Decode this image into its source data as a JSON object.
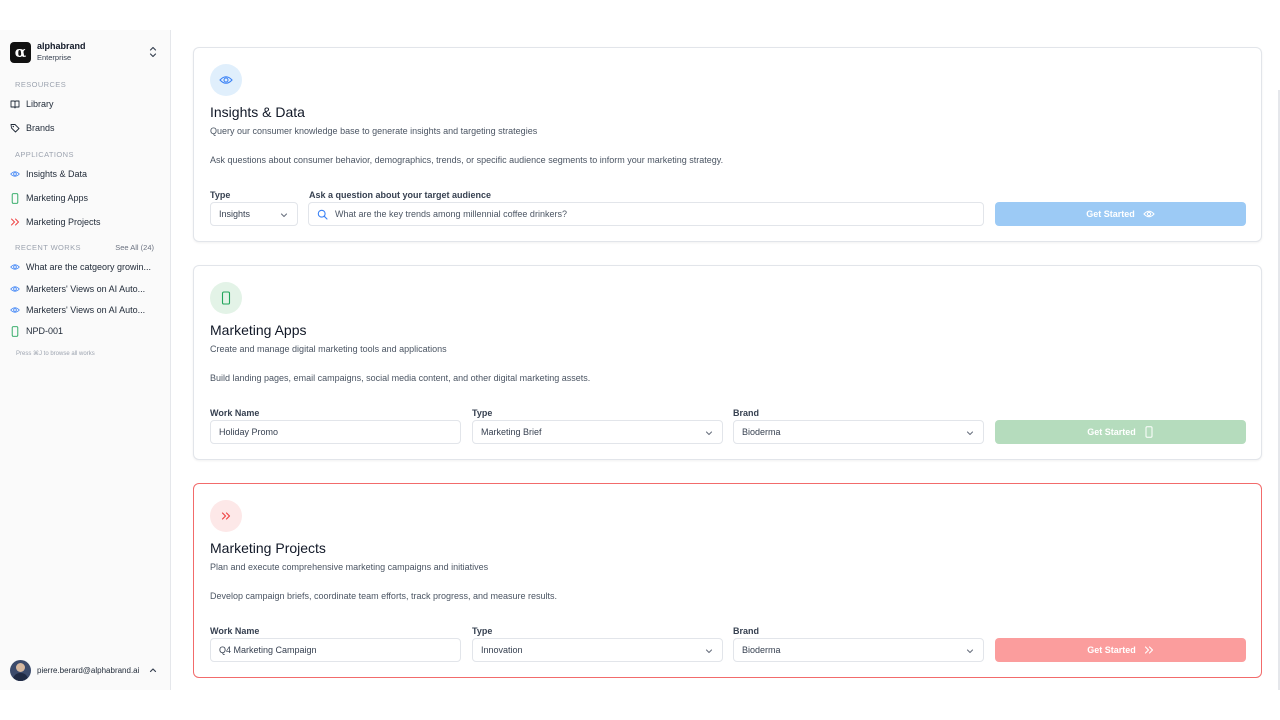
{
  "org": {
    "name": "alphabrand",
    "plan": "Enterprise",
    "logo": "α"
  },
  "sidebar": {
    "resources_label": "RESOURCES",
    "resources": [
      {
        "label": "Library",
        "icon": "book-icon"
      },
      {
        "label": "Brands",
        "icon": "tag-icon"
      }
    ],
    "applications_label": "APPLICATIONS",
    "applications": [
      {
        "label": "Insights & Data",
        "icon": "eye-icon"
      },
      {
        "label": "Marketing Apps",
        "icon": "phone-icon"
      },
      {
        "label": "Marketing Projects",
        "icon": "chevrons-right-icon"
      }
    ],
    "recent_label": "RECENT WORKS",
    "see_all": "See All (24)",
    "recent": [
      {
        "label": "What are the catgeory growin...",
        "icon": "eye-icon"
      },
      {
        "label": "Marketers' Views on AI Auto...",
        "icon": "eye-icon"
      },
      {
        "label": "Marketers' Views on AI Auto...",
        "icon": "eye-icon"
      },
      {
        "label": "NPD-001",
        "icon": "phone-icon"
      }
    ],
    "hint": "Press ⌘J to browse all works",
    "user_email": "pierre.berard@alphabrand.ai"
  },
  "cards": {
    "insights": {
      "title": "Insights & Data",
      "subtitle": "Query our consumer knowledge base to generate insights and targeting strategies",
      "description": "Ask questions about consumer behavior, demographics, trends, or specific audience segments to inform your marketing strategy.",
      "type_label": "Type",
      "type_value": "Insights",
      "question_label": "Ask a question about your target audience",
      "question_placeholder": "What are the key trends among millennial coffee drinkers?",
      "button": "Get Started"
    },
    "apps": {
      "title": "Marketing Apps",
      "subtitle": "Create and manage digital marketing tools and applications",
      "description": "Build landing pages, email campaigns, social media content, and other digital marketing assets.",
      "work_name_label": "Work Name",
      "work_name_value": "Holiday Promo",
      "type_label": "Type",
      "type_value": "Marketing Brief",
      "brand_label": "Brand",
      "brand_value": "Bioderma",
      "button": "Get Started"
    },
    "projects": {
      "title": "Marketing Projects",
      "subtitle": "Plan and execute comprehensive marketing campaigns and initiatives",
      "description": "Develop campaign briefs, coordinate team efforts, track progress, and measure results.",
      "work_name_label": "Work Name",
      "work_name_value": "Q4 Marketing Campaign",
      "type_label": "Type",
      "type_value": "Innovation",
      "brand_label": "Brand",
      "brand_value": "Bioderma",
      "button": "Get Started"
    }
  },
  "colors": {
    "insights_accent": "#3b82f6",
    "insights_button": "#9ccaf5",
    "apps_accent": "#22a55b",
    "apps_button": "#b5dcbd",
    "projects_accent": "#ef4444",
    "projects_button": "#fb9d9d"
  }
}
